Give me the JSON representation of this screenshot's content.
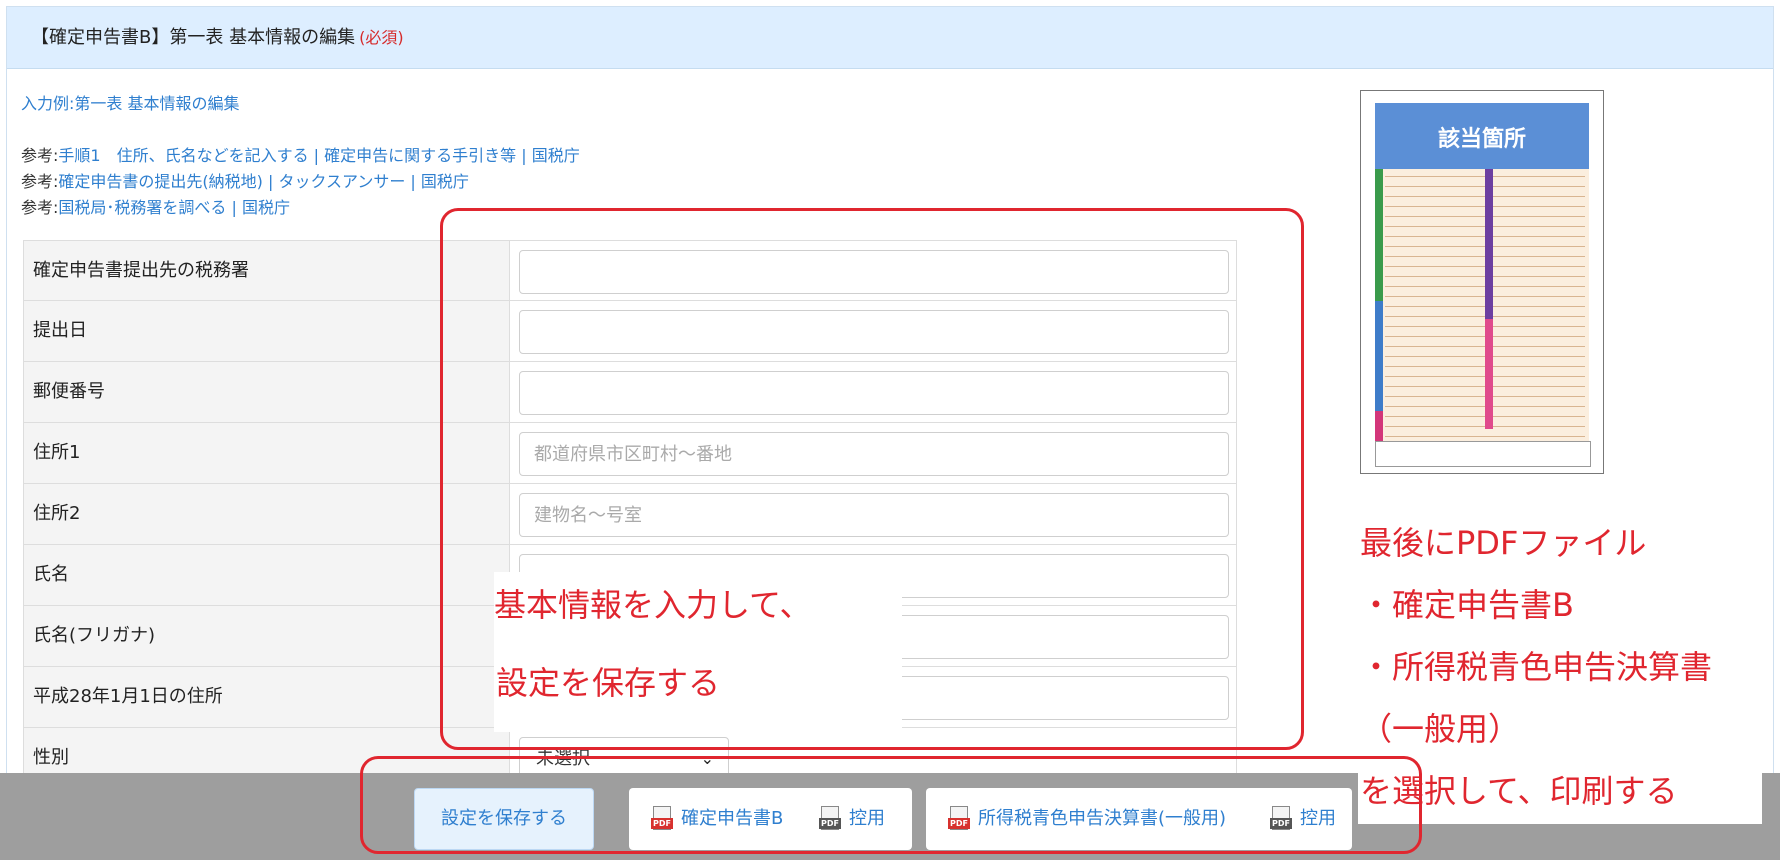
{
  "header": {
    "title": "【確定申告書B】第一表 基本情報の編集",
    "required": "(必須)"
  },
  "example_link": "入力例:第一表 基本情報の編集",
  "references": [
    {
      "prefix": "参考:",
      "link": "手順1　住所、氏名などを記入する | 確定申告に関する手引き等 | 国税庁"
    },
    {
      "prefix": "参考:",
      "link": "確定申告書の提出先(納税地) | タックスアンサー | 国税庁"
    },
    {
      "prefix": "参考:",
      "link": "国税局･税務署を調べる | 国税庁"
    }
  ],
  "form": {
    "rows": [
      {
        "label": "確定申告書提出先の税務署",
        "value": "",
        "placeholder": ""
      },
      {
        "label": "提出日",
        "value": "",
        "placeholder": ""
      },
      {
        "label": "郵便番号",
        "value": "",
        "placeholder": ""
      },
      {
        "label": "住所1",
        "value": "",
        "placeholder": "都道府県市区町村〜番地"
      },
      {
        "label": "住所2",
        "value": "",
        "placeholder": "建物名〜号室"
      },
      {
        "label": "氏名",
        "value": "",
        "placeholder": ""
      },
      {
        "label": "氏名(フリガナ)",
        "value": "",
        "placeholder": ""
      },
      {
        "label": "平成28年1月1日の住所",
        "value": "",
        "placeholder": ""
      }
    ],
    "gender": {
      "label": "性別",
      "selected": "未選択"
    }
  },
  "thumbnail": {
    "title": "該当箇所"
  },
  "annotations": {
    "center_line1": "基本情報を入力して、",
    "center_line2": "設定を保存する",
    "side_line1": "最後にPDFファイル",
    "side_line2": "・確定申告書B",
    "side_line3": "・所得税青色申告決算書",
    "side_line4": "（一般用）",
    "side_line5": "を選択して、印刷する"
  },
  "bottom": {
    "save_label": "設定を保存する",
    "pdf_b_label": "確定申告書B",
    "pdf_b_copy_label": "控用",
    "pdf_blue_label": "所得税青色申告決算書(一般用)",
    "pdf_blue_copy_label": "控用",
    "pdf_tag": "PDF"
  },
  "colors": {
    "accent": "#2f7fcf",
    "annotation": "#e0262f",
    "header_bg": "#ddeeff"
  }
}
